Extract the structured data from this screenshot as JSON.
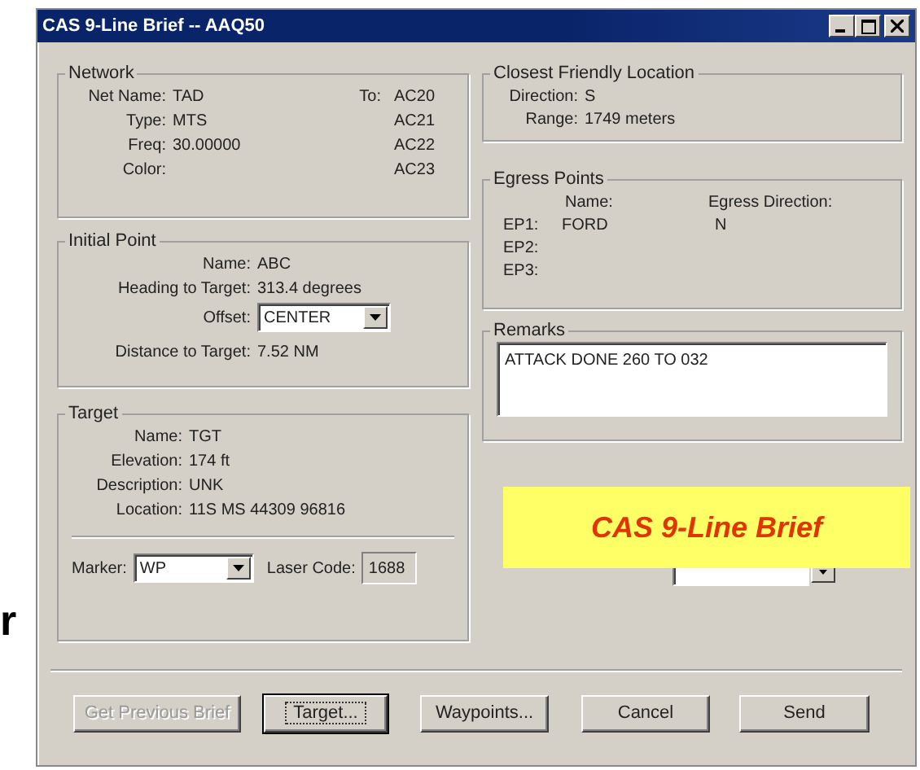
{
  "side_text": "r",
  "window": {
    "title": "CAS 9-Line Brief   -- AAQ50"
  },
  "network": {
    "title": "Network",
    "to_label": "To:",
    "rows": [
      {
        "label": "Net Name:",
        "value": "TAD",
        "to": "AC20"
      },
      {
        "label": "Type:",
        "value": "MTS",
        "to": "AC21"
      },
      {
        "label": "Freq:",
        "value": "30.00000",
        "to": "AC22"
      },
      {
        "label": "Color:",
        "to": "AC23"
      }
    ]
  },
  "initial_point": {
    "title": "Initial Point",
    "fields": [
      {
        "kind": "text",
        "label": "Name:",
        "value": "ABC"
      },
      {
        "kind": "text",
        "label": "Heading to Target:",
        "value": "313.4 degrees"
      },
      {
        "kind": "select",
        "label": "Offset:",
        "value": "CENTER"
      },
      {
        "kind": "text",
        "label": "Distance to Target:",
        "value": "7.52 NM"
      }
    ]
  },
  "target": {
    "title": "Target",
    "fields": [
      {
        "label": "Name:",
        "value": "TGT"
      },
      {
        "label": "Elevation:",
        "value": "174 ft"
      },
      {
        "label": "Description:",
        "value": "UNK"
      },
      {
        "label": "Location:",
        "value": "11S MS 44309 96816"
      }
    ],
    "marker": {
      "label": "Marker:",
      "value": "WP"
    },
    "laser_code": {
      "label": "Laser Code:",
      "value": "1688"
    }
  },
  "closest_friendly": {
    "title": "Closest Friendly Location",
    "fields": [
      {
        "label": "Direction:",
        "value": "S"
      },
      {
        "label": "Range:",
        "value": "1749 meters"
      }
    ]
  },
  "egress_points": {
    "title": "Egress Points",
    "headers": [
      "Name:",
      "Egress Direction:"
    ],
    "rows": [
      {
        "label": "EP1:",
        "name": "FORD",
        "direction": "N"
      },
      {
        "label": "EP2:"
      },
      {
        "label": "EP3:"
      }
    ]
  },
  "remarks": {
    "title": "Remarks",
    "value": "ATTACK DONE  260 TO 032"
  },
  "time_field": {
    "kind": "spinner"
  },
  "overlay": {
    "text": "CAS 9-Line Brief"
  },
  "buttons": [
    {
      "label": "Get Previous Brief",
      "disabled": true,
      "default": false
    },
    {
      "label": "Target...",
      "disabled": false,
      "default": true
    },
    {
      "label": "Waypoints...",
      "disabled": false,
      "default": false
    },
    {
      "label": "Cancel",
      "disabled": false,
      "default": false
    },
    {
      "label": "Send",
      "disabled": false,
      "default": false
    }
  ]
}
